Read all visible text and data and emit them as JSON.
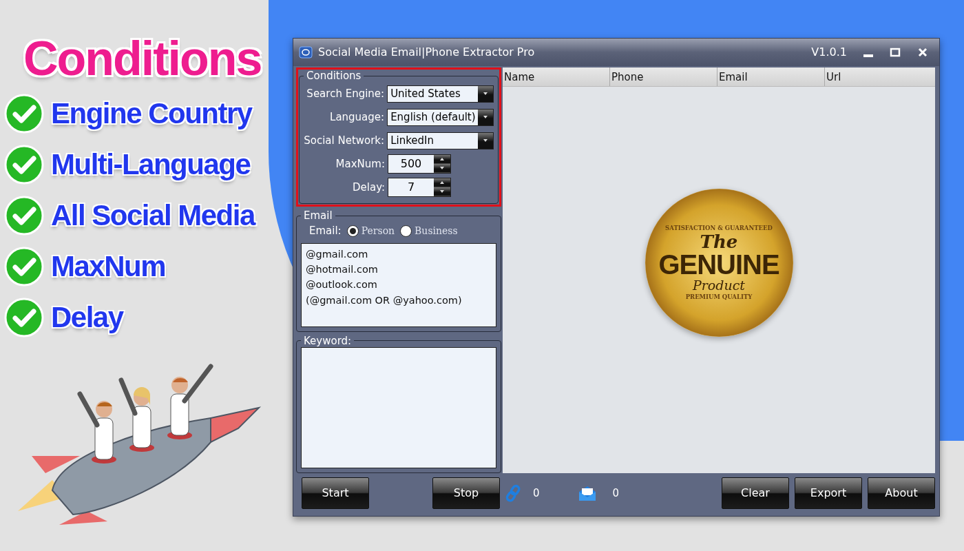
{
  "promo": {
    "headline": "Conditions",
    "features": [
      {
        "label": "Engine Country"
      },
      {
        "label": "Multi-Language"
      },
      {
        "label": "All Social Media"
      },
      {
        "label": "MaxNum"
      },
      {
        "label": "Delay"
      }
    ]
  },
  "window": {
    "title": "Social Media Email|Phone Extractor Pro",
    "version": "V1.0.1"
  },
  "conditions": {
    "title": "Conditions",
    "highlighted": true,
    "fields": [
      {
        "kind": "dropdown",
        "label": "Search Engine:",
        "value": "United States"
      },
      {
        "kind": "dropdown",
        "label": "Language:",
        "value": "English (default)"
      },
      {
        "kind": "dropdown",
        "label": "Social Network:",
        "value": "LinkedIn"
      },
      {
        "kind": "spinner",
        "label": "MaxNum:",
        "value": "500"
      },
      {
        "kind": "spinner",
        "label": "Delay:",
        "value": "7"
      }
    ]
  },
  "email": {
    "title": "Email",
    "label": "Email:",
    "options": [
      {
        "label": "Person",
        "selected": true
      },
      {
        "label": "Business",
        "selected": false
      }
    ],
    "domains": [
      "@gmail.com",
      "@hotmail.com",
      "@outlook.com",
      "(@gmail.com OR @yahoo.com)"
    ]
  },
  "keyword": {
    "title": "Keyword:"
  },
  "table": {
    "columns": [
      "Name",
      "Phone",
      "Email",
      "Url"
    ]
  },
  "seal": {
    "top_text": "SATISFACTION & GUARANTEED",
    "line_1": "The",
    "line_2": "GENUINE",
    "line_3": "Product",
    "bottom_text": "PREMIUM QUALITY"
  },
  "footer": {
    "left_buttons": [
      "Start",
      "Stop"
    ],
    "link_count": "0",
    "mail_count": "0",
    "right_buttons": [
      "Clear",
      "Export",
      "About"
    ]
  }
}
